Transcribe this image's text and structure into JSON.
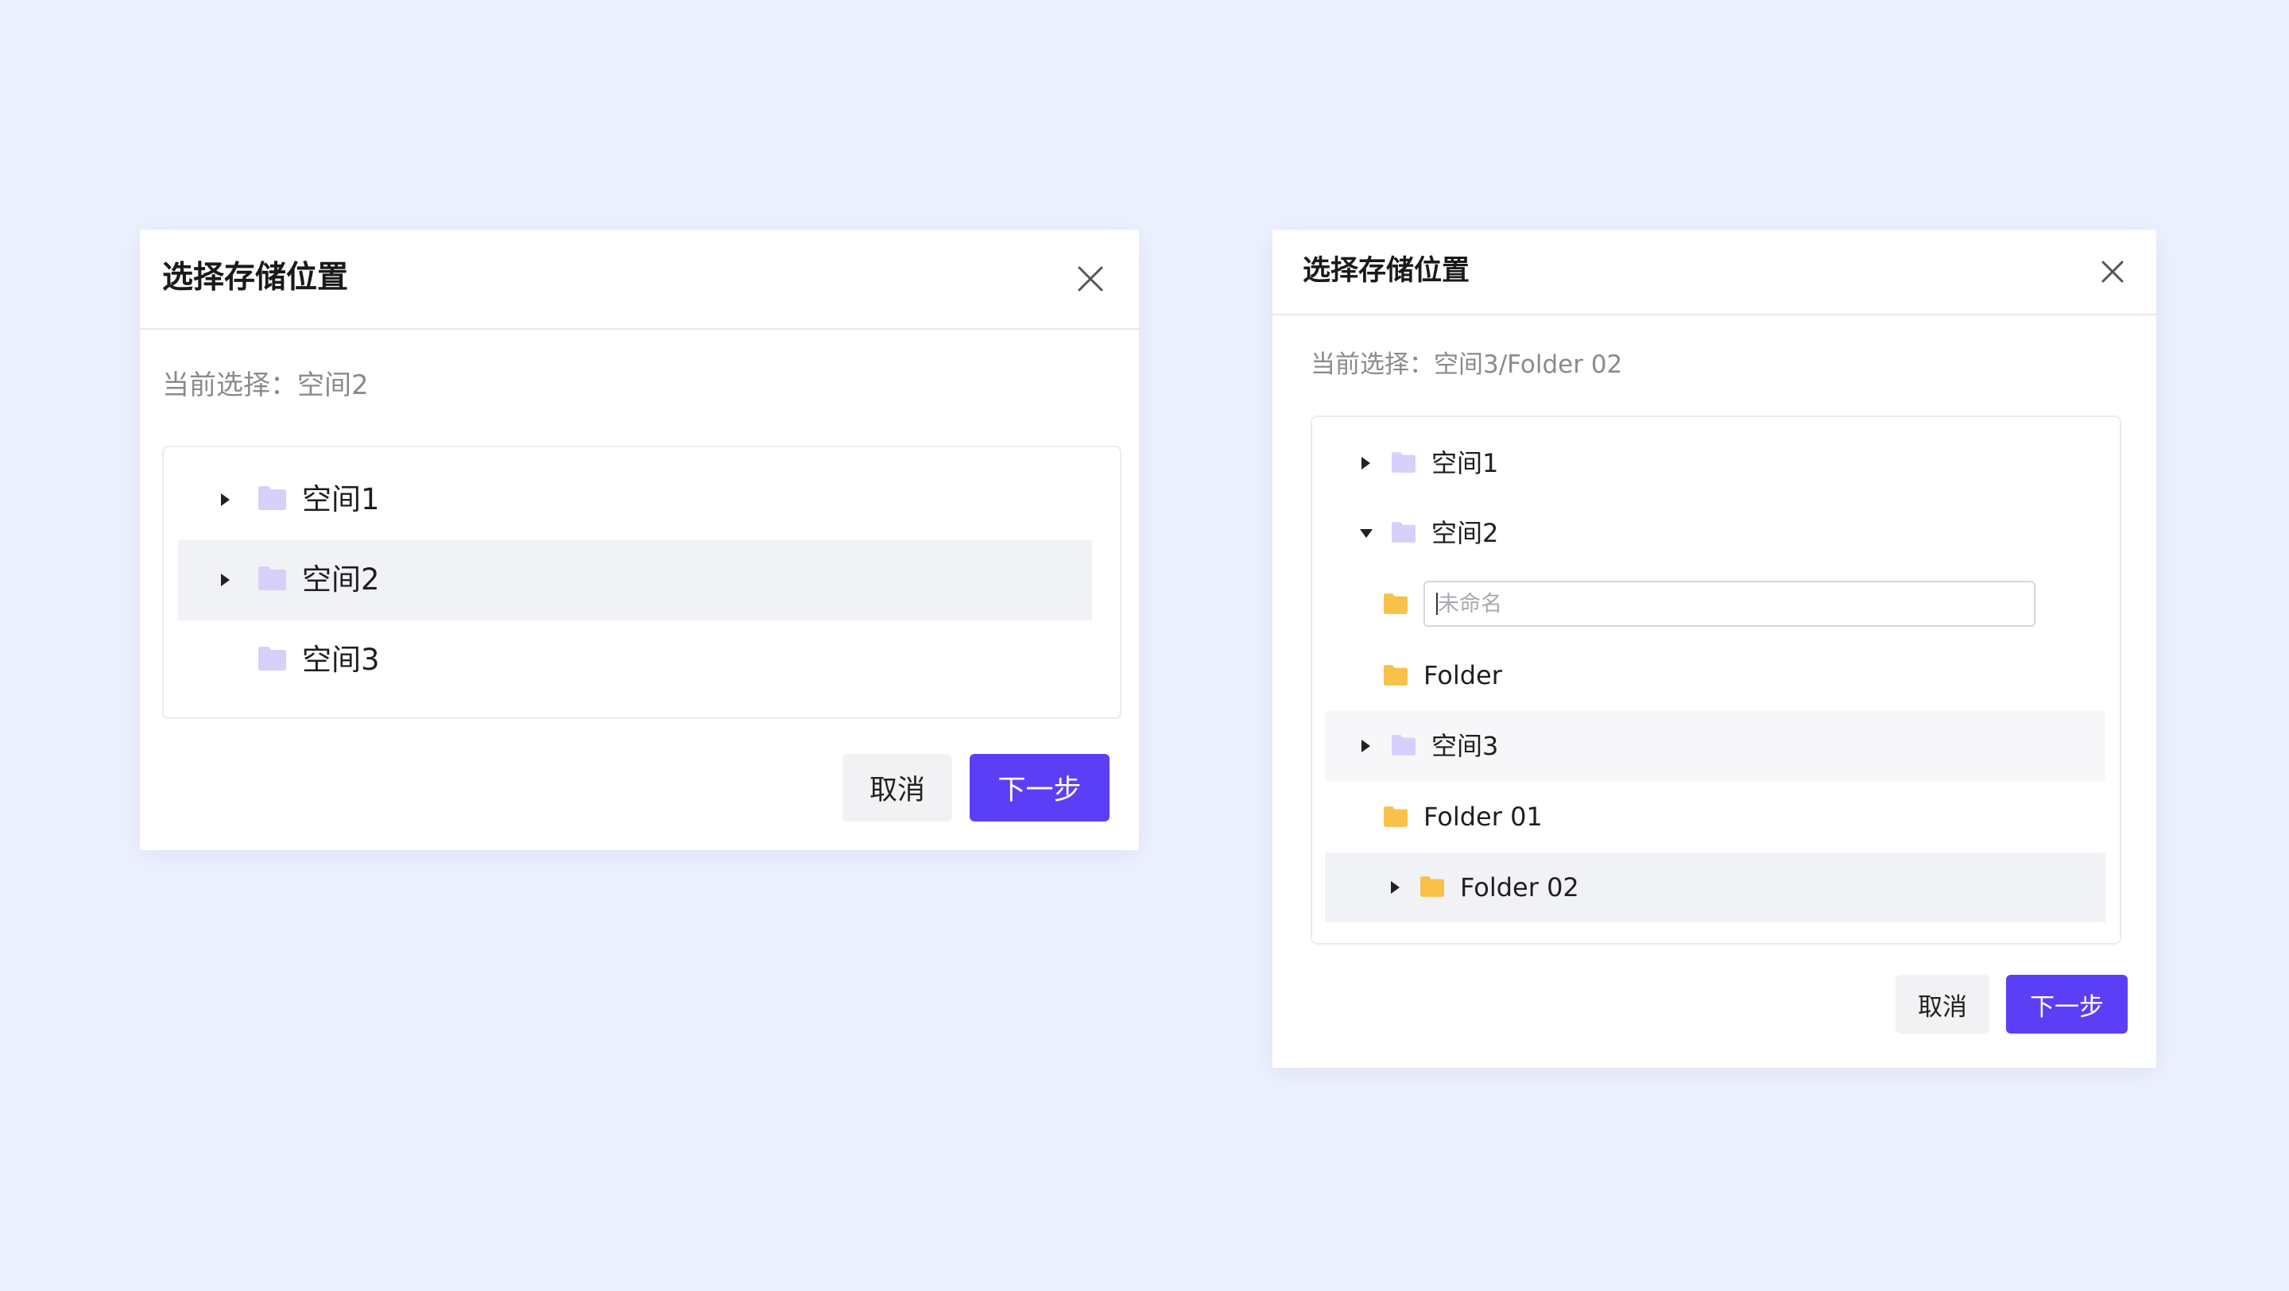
{
  "colors": {
    "page_bg": "#ecf1fe",
    "primary": "#5b3ff6",
    "space_folder": "#d6d0fb",
    "subfolder": "#f8c14a",
    "selected_row": "#f1f2f5"
  },
  "left_dialog": {
    "title": "选择存储位置",
    "close_icon": "close-icon",
    "current_selection": "当前选择：空间2",
    "tree": [
      {
        "label": "空间1",
        "expander": "collapsed",
        "icon": "folder-icon"
      },
      {
        "label": "空间2",
        "expander": "collapsed",
        "icon": "folder-icon",
        "selected": true
      },
      {
        "label": "空间3",
        "expander": "none",
        "icon": "folder-icon"
      }
    ],
    "cancel_label": "取消",
    "next_label": "下一步"
  },
  "right_dialog": {
    "title": "选择存储位置",
    "close_icon": "close-icon",
    "current_selection": "当前选择：空间3/Folder 02",
    "tree": [
      {
        "label": "空间1",
        "expander": "collapsed",
        "icon": "folder-icon"
      },
      {
        "label": "空间2",
        "expander": "expanded",
        "icon": "folder-icon"
      },
      {
        "type": "new-folder-input",
        "placeholder": "未命名",
        "icon": "folder-icon"
      },
      {
        "label": "Folder",
        "expander": "none",
        "icon": "folder-icon"
      },
      {
        "label": "空间3",
        "expander": "collapsed",
        "icon": "folder-icon",
        "hovered": true
      },
      {
        "label": "Folder 01",
        "expander": "none",
        "icon": "folder-icon"
      },
      {
        "label": "Folder 02",
        "expander": "collapsed",
        "icon": "folder-icon",
        "selected": true
      }
    ],
    "cancel_label": "取消",
    "next_label": "下一步"
  }
}
